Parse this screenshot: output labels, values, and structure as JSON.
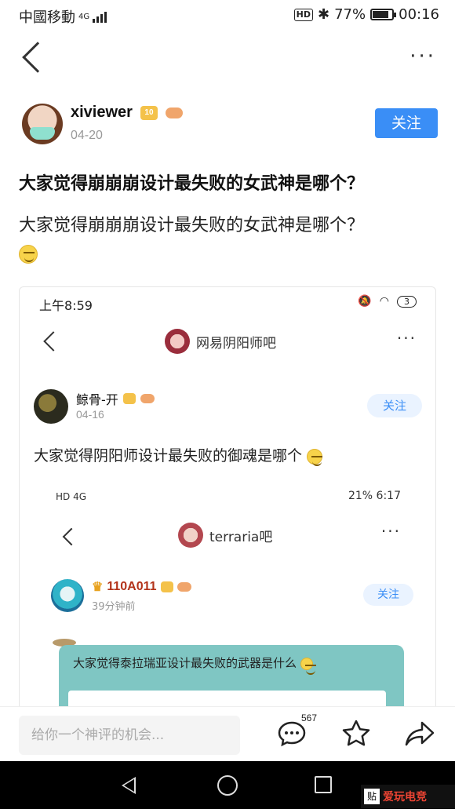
{
  "status_bar": {
    "carrier": "中國移動",
    "network": "4G",
    "hd": "HD",
    "battery": "77%",
    "time": "00:16"
  },
  "post": {
    "author": "xiviewer",
    "level": "10",
    "date": "04-20",
    "follow_label": "关注",
    "title": "大家觉得崩崩崩设计最失败的女武神是哪个？",
    "body": "大家觉得崩崩崩设计最失败的女武神是哪个？"
  },
  "embedded_1": {
    "status_time": "上午8:59",
    "status_battery": "3",
    "forum_name": "网易阴阳师吧",
    "author": "鲸骨-开",
    "date": "04-16",
    "follow_label": "关注",
    "text": "大家觉得阴阳师设计最失败的御魂是哪个"
  },
  "embedded_2": {
    "status_left": "HD 4G",
    "status_right": "21% 6:17",
    "forum_name": "terraria吧",
    "author": "110A011",
    "date": "39分钟前",
    "follow_label": "关注",
    "text": "大家觉得泰拉瑞亚设计最失败的武器是什么"
  },
  "bottom_bar": {
    "comment_placeholder": "给你一个神评的机会...",
    "comment_count": "567"
  },
  "icons": [
    "back-icon",
    "more-icon",
    "comment-icon",
    "star-icon",
    "share-icon",
    "nav-back-icon",
    "nav-home-icon",
    "nav-recents-icon"
  ],
  "watermark": {
    "box": "贴",
    "text": "爱玩电竞"
  },
  "colors": {
    "accent": "#3a8ef6"
  }
}
